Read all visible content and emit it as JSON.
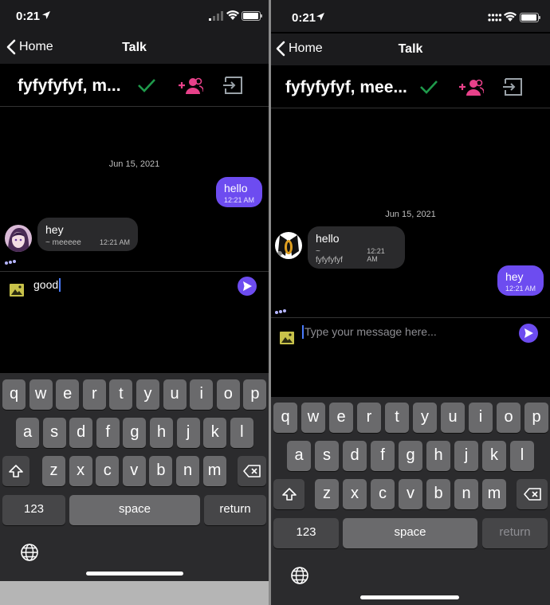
{
  "left": {
    "status": {
      "time": "0:21"
    },
    "nav": {
      "back_label": "Home",
      "title": "Talk"
    },
    "chat": {
      "room_name": "fyfyfyfyf, m..."
    },
    "date_divider": "Jun 15, 2021",
    "messages": [
      {
        "direction": "out",
        "text": "hello",
        "time": "12:21 AM"
      },
      {
        "direction": "in",
        "text": "hey",
        "sender": "~ meeeee",
        "time": "12:21 AM"
      }
    ],
    "composer": {
      "value": "good",
      "placeholder": "Type your message here..."
    },
    "keyboard": {
      "row1": [
        "q",
        "w",
        "e",
        "r",
        "t",
        "y",
        "u",
        "i",
        "o",
        "p"
      ],
      "row2": [
        "a",
        "s",
        "d",
        "f",
        "g",
        "h",
        "j",
        "k",
        "l"
      ],
      "row3": [
        "z",
        "x",
        "c",
        "v",
        "b",
        "n",
        "m"
      ],
      "numbers": "123",
      "space": "space",
      "return": "return"
    }
  },
  "right": {
    "status": {
      "time": "0:21"
    },
    "nav": {
      "back_label": "Home",
      "title": "Talk"
    },
    "chat": {
      "room_name": "fyfyfyfyf, mee..."
    },
    "date_divider": "Jun 15, 2021",
    "messages": [
      {
        "direction": "in",
        "text": "hello",
        "sender": "~ fyfyfyfyf",
        "time": "12:21 AM"
      },
      {
        "direction": "out",
        "text": "hey",
        "time": "12:21 AM"
      }
    ],
    "composer": {
      "value": "",
      "placeholder": "Type your message here..."
    },
    "keyboard": {
      "row1": [
        "q",
        "w",
        "e",
        "r",
        "t",
        "y",
        "u",
        "i",
        "o",
        "p"
      ],
      "row2": [
        "a",
        "s",
        "d",
        "f",
        "g",
        "h",
        "j",
        "k",
        "l"
      ],
      "row3": [
        "z",
        "x",
        "c",
        "v",
        "b",
        "n",
        "m"
      ],
      "numbers": "123",
      "space": "space",
      "return": "return"
    }
  },
  "colors": {
    "accent": "#6d4cf0",
    "confirm": "#1f9a4b",
    "add_people": "#e8418a",
    "leave": "#9aa2a8",
    "image_icon": "#c8c24a"
  },
  "icons": [
    "location-arrow-icon",
    "cellular-signal-icon",
    "wifi-icon",
    "battery-icon",
    "chevron-left-icon",
    "checkmark-icon",
    "add-people-icon",
    "exit-icon",
    "image-icon",
    "send-icon",
    "typing-indicator-icon",
    "shift-icon",
    "delete-icon",
    "globe-icon"
  ]
}
